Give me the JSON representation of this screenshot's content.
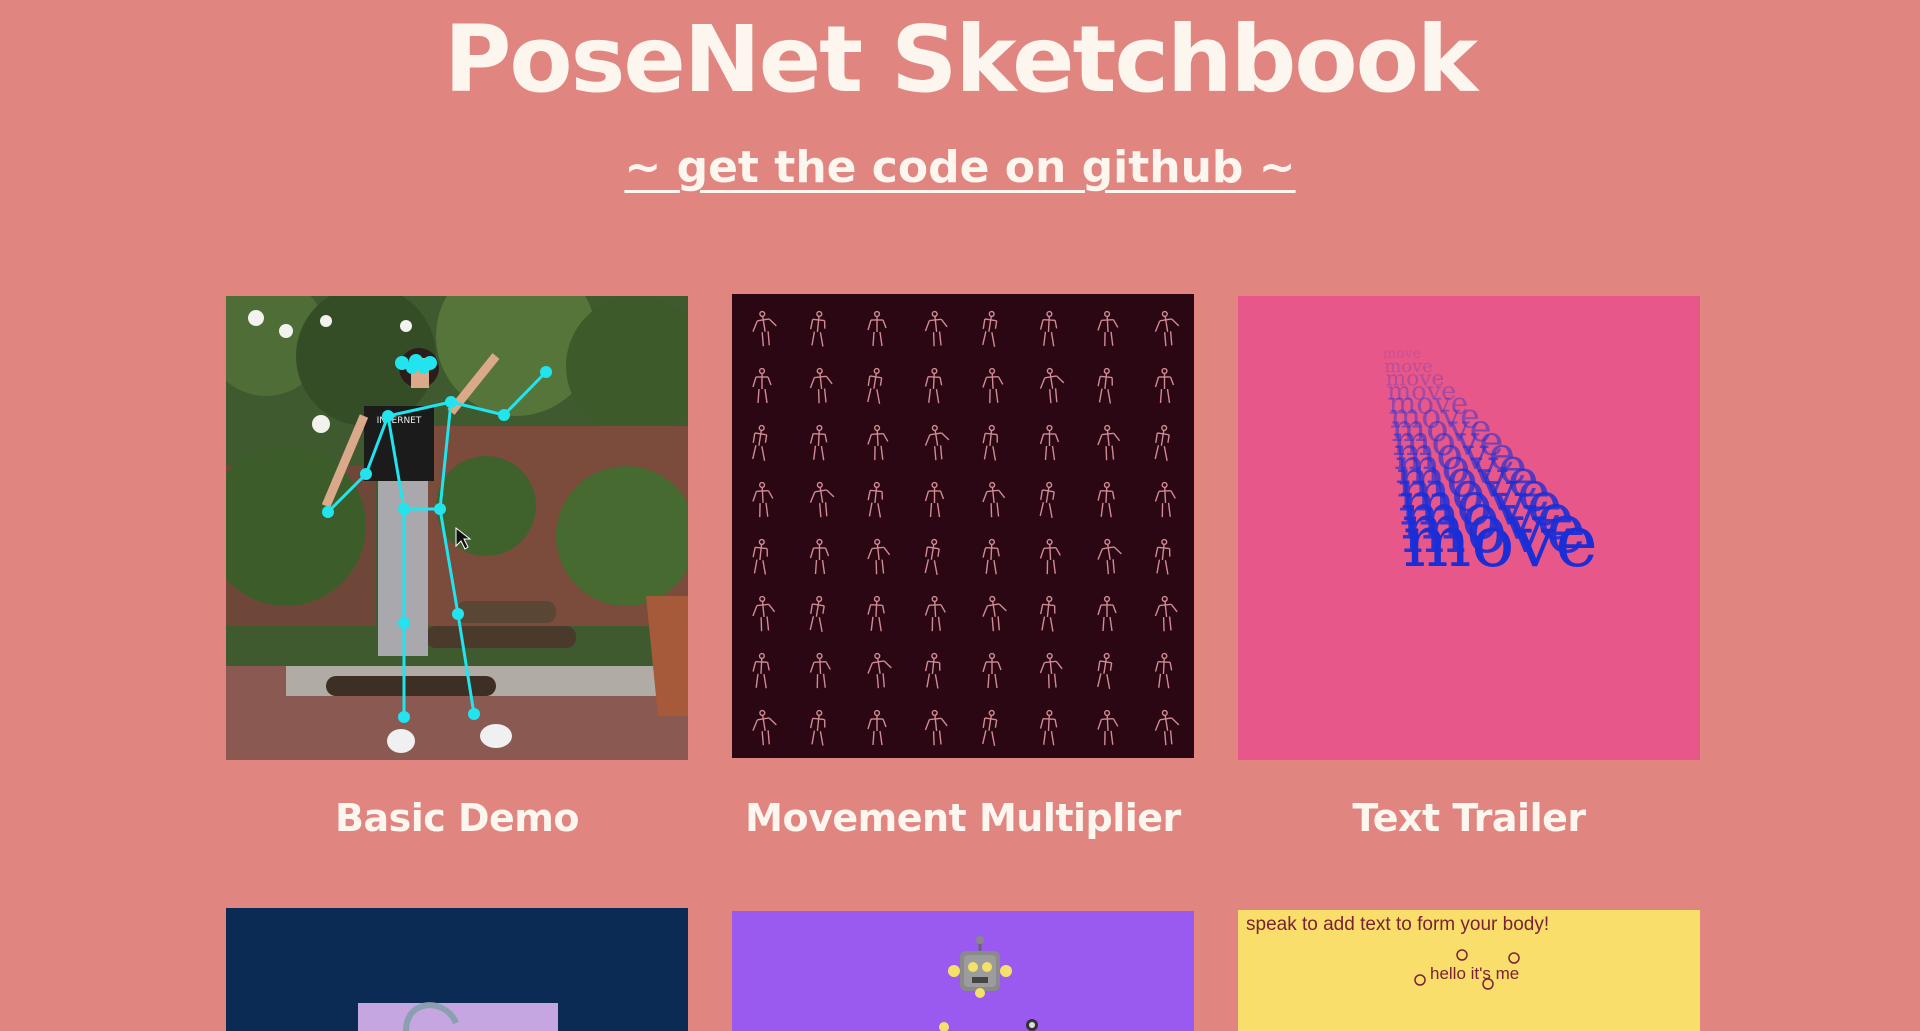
{
  "header": {
    "title": "PoseNet Sketchbook",
    "github_link": "~ get the code on github ~"
  },
  "colors": {
    "background": "#e08580",
    "text": "#fdf6ef",
    "skeleton": "#21e4ee",
    "multiplier_bg": "#2a0713",
    "text_trailer_bg": "#e7578a",
    "move_text": "#1b2ed6",
    "navy_bg": "#0b2a54",
    "purple_bg": "#9b5aef",
    "yellow_bg": "#f9de6c"
  },
  "cards": [
    {
      "title": "Basic Demo",
      "thumb_icon": "photo-pose-icon"
    },
    {
      "title": "Movement Multiplier",
      "thumb_icon": "skeleton-grid-icon"
    },
    {
      "title": "Text Trailer",
      "thumb_icon": "move-text-icon",
      "thumb_text": "move"
    },
    {
      "title": "",
      "thumb_icon": "figure-icon"
    },
    {
      "title": "",
      "thumb_icon": "robot-icon"
    },
    {
      "title": "",
      "thumb_icon": "speech-text-icon",
      "thumb_text": "speak to add text to form your body!",
      "thumb_subtext": "hello it's me"
    }
  ]
}
